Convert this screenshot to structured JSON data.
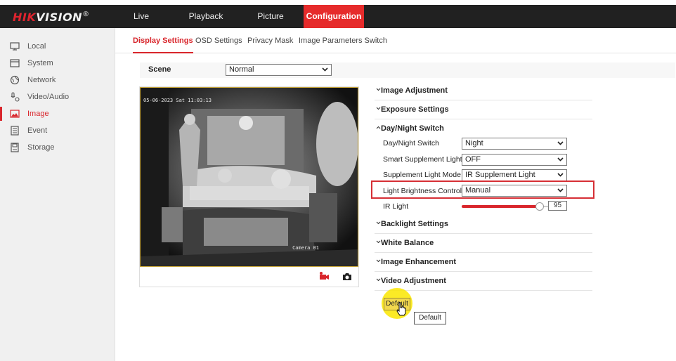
{
  "brand": {
    "logo_main": "HIK",
    "logo_sub": "VISION",
    "logo_reg": "®"
  },
  "nav": {
    "tabs": [
      {
        "label": "Live View"
      },
      {
        "label": "Playback"
      },
      {
        "label": "Picture"
      },
      {
        "label": "Configuration"
      }
    ],
    "active": "Configuration"
  },
  "sidebar": {
    "items": [
      {
        "label": "Local",
        "icon": "monitor-icon"
      },
      {
        "label": "System",
        "icon": "window-icon"
      },
      {
        "label": "Network",
        "icon": "globe-icon"
      },
      {
        "label": "Video/Audio",
        "icon": "audio-video-icon"
      },
      {
        "label": "Image",
        "icon": "image-icon"
      },
      {
        "label": "Event",
        "icon": "event-list-icon"
      },
      {
        "label": "Storage",
        "icon": "storage-icon"
      }
    ],
    "active": "Image"
  },
  "subtabs": {
    "items": [
      {
        "label": "Display Settings"
      },
      {
        "label": "OSD Settings"
      },
      {
        "label": "Privacy Mask"
      },
      {
        "label": "Image Parameters Switch"
      }
    ],
    "active": "Display Settings"
  },
  "scene": {
    "label": "Scene",
    "value": "Normal"
  },
  "video": {
    "osd_time": "05-06-2023 Sat 11:03:13",
    "osd_camera": "Camera 01",
    "tools": [
      "record-icon",
      "camera-icon"
    ]
  },
  "sections": {
    "image_adjustment": "Image Adjustment",
    "exposure_settings": "Exposure Settings",
    "day_night_switch": "Day/Night Switch",
    "backlight_settings": "Backlight Settings",
    "white_balance": "White Balance",
    "image_enhancement": "Image Enhancement",
    "video_adjustment": "Video Adjustment"
  },
  "daynight": {
    "day_night_switch": {
      "label": "Day/Night Switch",
      "value": "Night"
    },
    "smart_supplement_light": {
      "label": "Smart Supplement Light",
      "value": "OFF"
    },
    "supplement_light_mode": {
      "label": "Supplement Light Mode",
      "value": "IR Supplement Light"
    },
    "light_brightness_control": {
      "label": "Light Brightness Control",
      "value": "Manual"
    },
    "ir_light": {
      "label": "IR Light",
      "value": "95",
      "fraction": 0.95
    }
  },
  "actions": {
    "default_label": "Default",
    "tooltip": "Default"
  },
  "colors": {
    "accent": "#d9262c",
    "topbar": "#212121",
    "button": "#f3d94d",
    "cursor_halo": "#fae600"
  }
}
